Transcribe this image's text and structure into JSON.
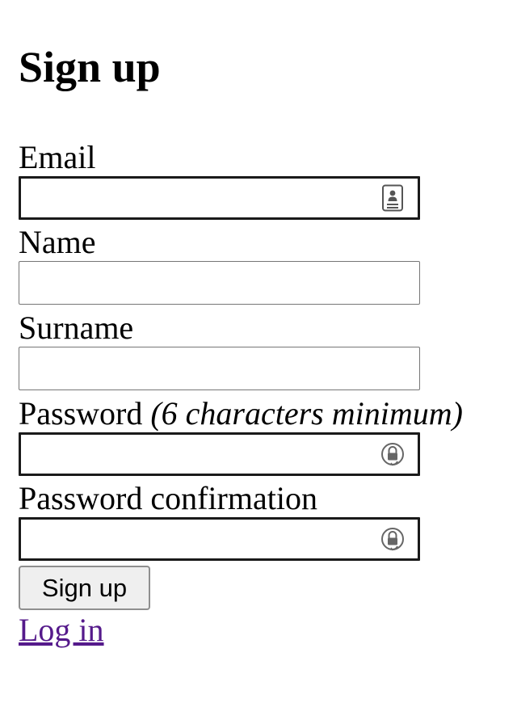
{
  "heading": "Sign up",
  "fields": {
    "email": {
      "label": "Email",
      "value": "",
      "icon": "autofill-contact-card-icon"
    },
    "name": {
      "label": "Name",
      "value": ""
    },
    "surname": {
      "label": "Surname",
      "value": ""
    },
    "password": {
      "label": "Password",
      "hint": "(6 characters minimum)",
      "value": "",
      "icon": "password-manager-lock-icon"
    },
    "password_confirmation": {
      "label": "Password confirmation",
      "value": "",
      "icon": "password-manager-lock-icon"
    }
  },
  "submit_label": "Sign up",
  "login_link": "Log in",
  "colors": {
    "link": "#551a8b",
    "button_bg": "#efefef",
    "input_border": "#767676",
    "focused_border": "#1a1a1a"
  }
}
